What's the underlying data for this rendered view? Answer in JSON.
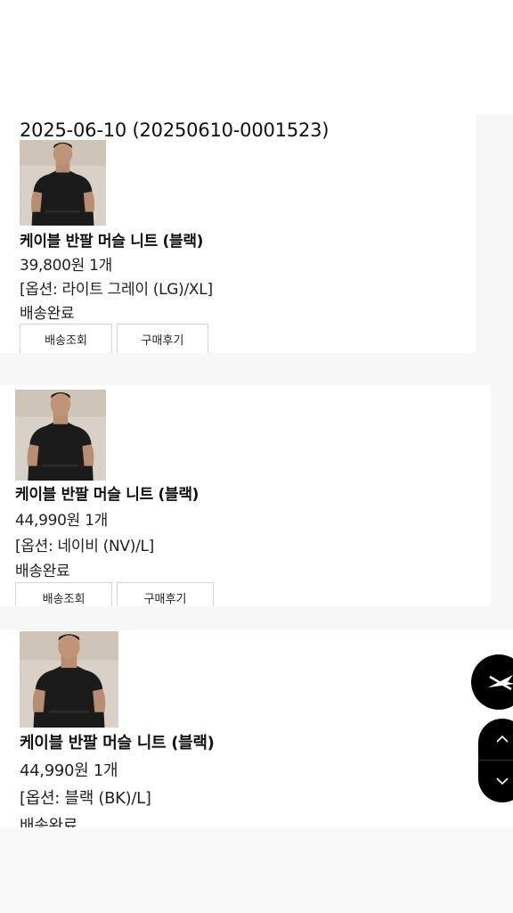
{
  "orders": [
    {
      "date": "2025-06-10 (20250610-0001523)",
      "name": "케이블 반팔 머슬 니트 (블랙)",
      "price": "39,800원 1개",
      "option": "[옵션: 라이트 그레이 (LG)/XL]",
      "status": "배송완료",
      "buttons": {
        "track": "배송조회",
        "review": "구매후기"
      }
    },
    {
      "name": "케이블 반팔 머슬 니트 (블랙)",
      "price": "44,990원 1개",
      "option": "[옵션: 네이비 (NV)/L]",
      "status": "배송완료",
      "buttons": {
        "track": "배송조회",
        "review": "구매후기"
      }
    },
    {
      "name": "케이블 반팔 머슬 니트 (블랙)",
      "price": "44,990원 1개",
      "option": "[옵션: 블랙 (BK)/L]",
      "status": "배송완료"
    }
  ],
  "floating": {
    "logo_icon": "brand-logo-icon",
    "up_icon": "chevron-up-icon",
    "down_icon": "chevron-down-icon"
  },
  "colors": {
    "background": "#f7f7f7",
    "card": "#ffffff",
    "fab": "#000000"
  }
}
